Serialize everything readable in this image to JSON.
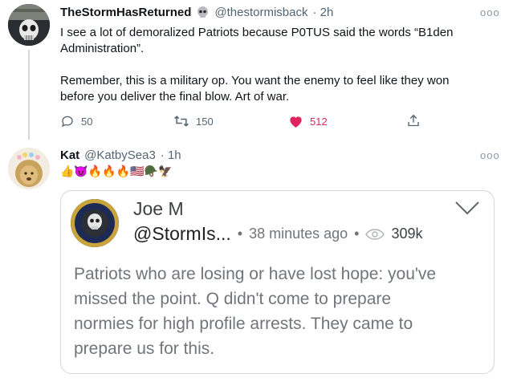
{
  "tweet1": {
    "name": "TheStormHasReturned",
    "badge_icon": "skull-emoji",
    "handle": "@thestormisback",
    "time": "· 2h",
    "text_line1": "I see a lot of demoralized Patriots because P0TUS said the words “B1den",
    "text_line2": "Administration”.",
    "text_line3": "Remember, this is a military op. You want the enemy to feel like they won",
    "text_line4": "before you deliver the final blow. Art of war.",
    "replies": "50",
    "retweets": "150",
    "likes": "512",
    "like_color": "#e0245e"
  },
  "tweet2": {
    "name": "Kat",
    "handle": "@KatbySea3",
    "time": "· 1h",
    "emoji": "👍😈🔥🔥🔥🇺🇸🪖🦅"
  },
  "quote": {
    "name": "Joe M",
    "handle": "@StormIs...",
    "time": "38 minutes ago",
    "views": "309k",
    "line1": "Patriots who are losing or have lost hope: you've",
    "line2": "missed the point. Q didn't come to prepare",
    "line3": "normies for high profile arrests. They came to",
    "line4": "prepare us for this."
  }
}
